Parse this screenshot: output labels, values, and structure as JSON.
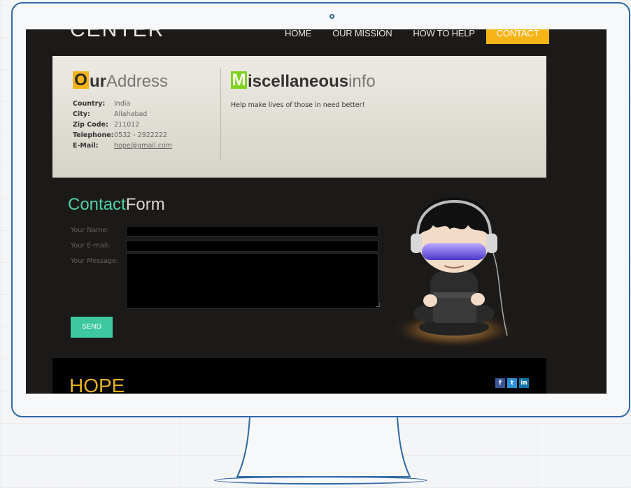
{
  "header": {
    "logo": "CENTER",
    "nav": [
      "HOME",
      "OUR MISSION",
      "HOW TO HELP",
      "CONTACT"
    ]
  },
  "address": {
    "heading_cap": "O",
    "heading_bold": "ur",
    "heading_rest": "Address",
    "rows": [
      {
        "label": "Country:",
        "value": "India"
      },
      {
        "label": "City:",
        "value": "Allahabad"
      },
      {
        "label": "Zip Code:",
        "value": "211012"
      },
      {
        "label": "Telephone:",
        "value": "0532 - 2922222"
      },
      {
        "label": "E-Mail:",
        "value": "hope@gmail.com"
      }
    ]
  },
  "misc": {
    "heading_cap": "M",
    "heading_bold": "iscellaneous",
    "heading_rest": "info",
    "text": "Help make lives of those in need better!"
  },
  "contact": {
    "title_bold": "Contact",
    "title_rest": "Form",
    "name_label": "Your Name:",
    "email_label": "Your E-mail:",
    "message_label": "Your Message:",
    "send_label": "SEND"
  },
  "footer": {
    "logo": "HOPE",
    "social": [
      "f",
      "t",
      "in"
    ]
  },
  "colors": {
    "accent_yellow": "#f6b416",
    "accent_green": "#7ed320",
    "accent_teal": "#3ec8a0",
    "monitor_frame": "#2f67a5"
  },
  "icons": {
    "mascot": "cartoon-boy-with-headphones-laptop-illustration"
  }
}
